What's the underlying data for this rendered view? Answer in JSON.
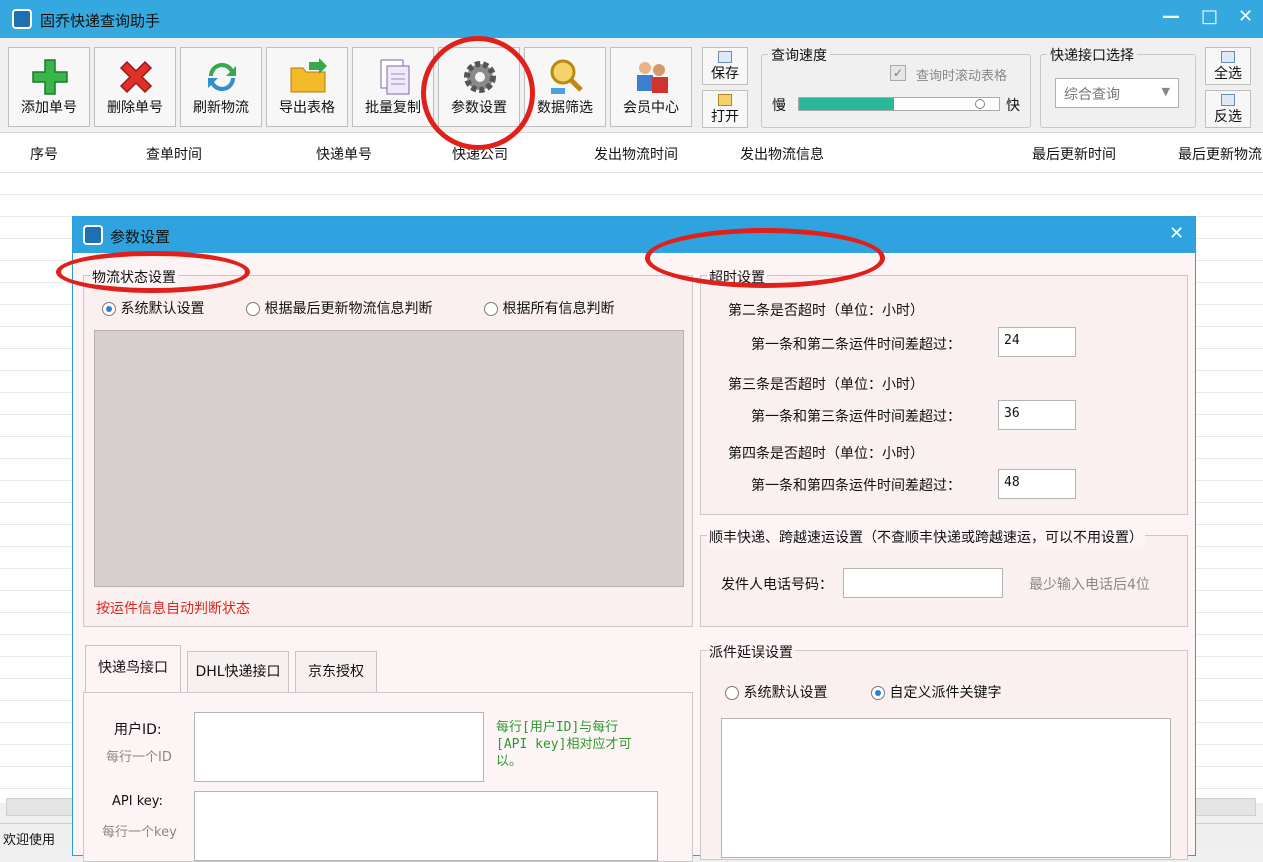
{
  "window": {
    "title": "固乔快递查询助手"
  },
  "toolbar": {
    "buttons": [
      {
        "label": "添加单号",
        "icon": "add-plus-icon"
      },
      {
        "label": "删除单号",
        "icon": "delete-x-icon"
      },
      {
        "label": "刷新物流",
        "icon": "refresh-icon"
      },
      {
        "label": "导出表格",
        "icon": "folder-export-icon"
      },
      {
        "label": "批量复制",
        "icon": "copy-pages-icon"
      },
      {
        "label": "参数设置",
        "icon": "gear-icon"
      },
      {
        "label": "数据筛选",
        "icon": "magnifier-filter-icon"
      },
      {
        "label": "会员中心",
        "icon": "members-icon"
      }
    ],
    "save_label": "保存",
    "open_label": "打开",
    "speed": {
      "title": "查询速度",
      "scroll_checkbox_label": "查询时滚动表格",
      "slow": "慢",
      "fast": "快",
      "value": 0.95
    },
    "api": {
      "title": "快递接口选择",
      "selected": "综合查询"
    },
    "select_all": "全选",
    "invert": "反选"
  },
  "grid": {
    "headers": [
      "序号",
      "查单时间",
      "快递单号",
      "快递公司",
      "发出物流时间",
      "发出物流信息",
      "最后更新时间",
      "最后更新物流"
    ]
  },
  "status_bar": {
    "text": "欢迎使用"
  },
  "dialog": {
    "title": "参数设置",
    "logistics": {
      "title": "物流状态设置",
      "options": [
        "系统默认设置",
        "根据最后更新物流信息判断",
        "根据所有信息判断"
      ],
      "selected": 0,
      "hint": "按运件信息自动判断状态"
    },
    "timeout": {
      "title": "超时设置",
      "rows": [
        {
          "heading": "第二条是否超时（单位：小时）",
          "label": "第一条和第二条运件时间差超过：",
          "value": "24"
        },
        {
          "heading": "第三条是否超时（单位：小时）",
          "label": "第一条和第三条运件时间差超过：",
          "value": "36"
        },
        {
          "heading": "第四条是否超时（单位：小时）",
          "label": "第一条和第四条运件时间差超过：",
          "value": "48"
        }
      ]
    },
    "sf": {
      "title": "顺丰快递、跨越速运设置（不查顺丰快递或跨越速运，可以不用设置）",
      "phone_label": "发件人电话号码：",
      "phone_hint": "最少输入电话后4位"
    },
    "tabs": [
      "快递鸟接口",
      "DHL快递接口",
      "京东授权"
    ],
    "kdn": {
      "user_label": "用户ID:",
      "user_sub": "每行一个ID",
      "key_label": "API key:",
      "key_sub": "每行一个key",
      "note": "每行[用户ID]与每行[API key]相对应才可以。"
    },
    "delay": {
      "title": "派件延误设置",
      "options": [
        "系统默认设置",
        "自定义派件关键字"
      ],
      "selected": 1
    }
  },
  "colors": {
    "titlebar": "#35a8e0",
    "annotation": "#e0201b",
    "note_green": "#2a9a2a",
    "hint_red": "#d9281e"
  }
}
